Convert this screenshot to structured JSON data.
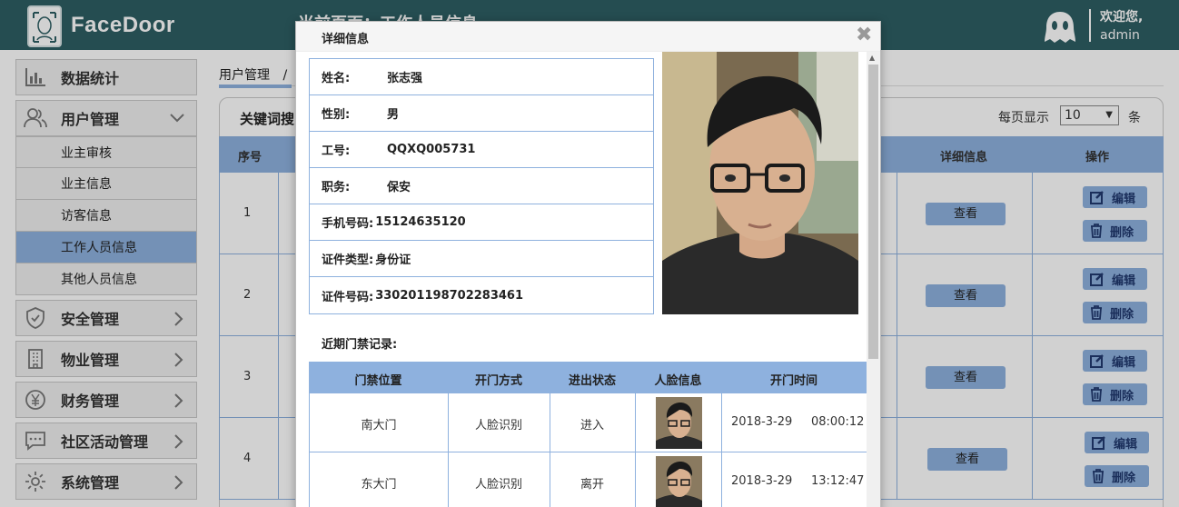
{
  "header": {
    "app_name": "FaceDoor",
    "partial_title": "当前页面：工作人员信息",
    "welcome": "欢迎您,",
    "username": "admin"
  },
  "sidebar": {
    "items": [
      {
        "label": "数据统计",
        "icon": "bar-chart-icon"
      },
      {
        "label": "用户管理",
        "icon": "users-icon",
        "expanded": true
      },
      {
        "label": "安全管理",
        "icon": "shield-icon"
      },
      {
        "label": "物业管理",
        "icon": "building-icon"
      },
      {
        "label": "财务管理",
        "icon": "yen-icon"
      },
      {
        "label": "社区活动管理",
        "icon": "chat-icon"
      },
      {
        "label": "系统管理",
        "icon": "gear-icon"
      }
    ],
    "subitems": [
      "业主审核",
      "业主信息",
      "访客信息",
      "工作人员信息",
      "其他人员信息"
    ],
    "active_sub": "工作人员信息"
  },
  "breadcrumb": {
    "first": "用户管理",
    "sep": "/"
  },
  "toolbar": {
    "keyword_label": "关键词搜",
    "per_page_label": "每页显示",
    "per_page_value": "10",
    "per_page_unit": "条"
  },
  "table": {
    "headers": {
      "no": "序号",
      "detail": "详细信息",
      "ops": "操作"
    },
    "rows": [
      "1",
      "2",
      "3",
      "4"
    ],
    "view_label": "查看",
    "edit_label": "编辑",
    "delete_label": "删除"
  },
  "modal": {
    "title": "详细信息",
    "close": "✖",
    "fields": [
      {
        "label": "姓名:",
        "value": "张志强"
      },
      {
        "label": "性别:",
        "value": "男"
      },
      {
        "label": "工号:",
        "value": "QQXQ005731"
      },
      {
        "label": "职务:",
        "value": "保安"
      },
      {
        "label": "手机号码:",
        "value": "15124635120"
      },
      {
        "label": "证件类型:",
        "value": "身份证"
      },
      {
        "label": "证件号码:",
        "value": "330201198702283461"
      }
    ],
    "recent_title": "近期门禁记录:",
    "rec_headers": [
      "门禁位置",
      "开门方式",
      "进出状态",
      "人脸信息",
      "开门时间"
    ],
    "records": [
      {
        "location": "南大门",
        "method": "人脸识别",
        "status": "进入",
        "date": "2018-3-29",
        "time": "08:00:12"
      },
      {
        "location": "东大门",
        "method": "人脸识别",
        "status": "离开",
        "date": "2018-3-29",
        "time": "13:12:47"
      }
    ]
  },
  "colors": {
    "header_bg": "#2e5e63",
    "accent": "#8eb1de",
    "button_text": "#223a70"
  }
}
